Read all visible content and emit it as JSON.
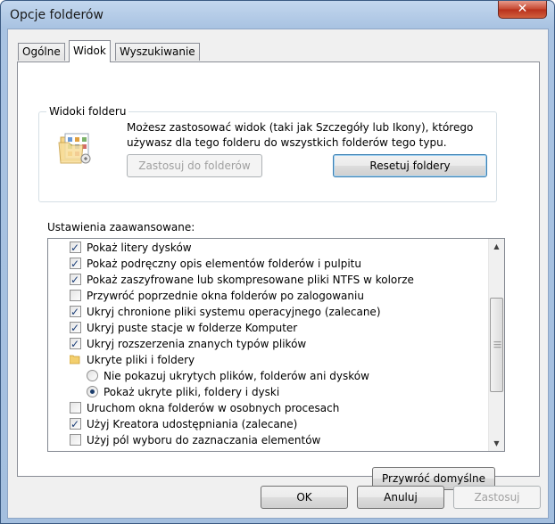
{
  "window": {
    "title": "Opcje folderów",
    "close_glyph": "✕"
  },
  "tabs": [
    {
      "label": "Ogólne",
      "active": false
    },
    {
      "label": "Widok",
      "active": true
    },
    {
      "label": "Wyszukiwanie",
      "active": false
    }
  ],
  "folder_views": {
    "group_label": "Widoki folderu",
    "description": "Możesz zastosować widok (taki jak Szczegóły lub Ikony), którego używasz dla tego folderu do wszystkich folderów tego typu.",
    "apply_button": "Zastosuj do folderów",
    "reset_button": "Resetuj foldery"
  },
  "advanced": {
    "label": "Ustawienia zaawansowane:",
    "items": [
      {
        "type": "checkbox",
        "checked": true,
        "indent": 0,
        "label": "Pokaż litery dysków"
      },
      {
        "type": "checkbox",
        "checked": true,
        "indent": 0,
        "label": "Pokaż podręczny opis elementów folderów i pulpitu"
      },
      {
        "type": "checkbox",
        "checked": true,
        "indent": 0,
        "label": "Pokaż zaszyfrowane lub skompresowane pliki NTFS w kolorze"
      },
      {
        "type": "checkbox",
        "checked": false,
        "indent": 0,
        "label": "Przywróć poprzednie okna folderów po zalogowaniu"
      },
      {
        "type": "checkbox",
        "checked": true,
        "indent": 0,
        "label": "Ukryj chronione pliki systemu operacyjnego (zalecane)"
      },
      {
        "type": "checkbox",
        "checked": true,
        "indent": 0,
        "label": "Ukryj puste stacje w folderze Komputer"
      },
      {
        "type": "checkbox",
        "checked": true,
        "indent": 0,
        "label": "Ukryj rozszerzenia znanych typów plików"
      },
      {
        "type": "folder",
        "checked": false,
        "indent": 0,
        "label": "Ukryte pliki i foldery"
      },
      {
        "type": "radio",
        "checked": false,
        "indent": 1,
        "label": "Nie pokazuj ukrytych plików, folderów ani dysków"
      },
      {
        "type": "radio",
        "checked": true,
        "indent": 1,
        "label": "Pokaż ukryte pliki, foldery i dyski"
      },
      {
        "type": "checkbox",
        "checked": false,
        "indent": 0,
        "label": "Uruchom okna folderów w osobnych procesach"
      },
      {
        "type": "checkbox",
        "checked": true,
        "indent": 0,
        "label": "Użyj Kreatora udostępniania (zalecane)"
      },
      {
        "type": "checkbox",
        "checked": false,
        "indent": 0,
        "label": "Użyj pól wyboru do zaznaczania elementów"
      }
    ]
  },
  "restore_defaults_button": "Przywróć domyślne",
  "footer": {
    "ok": "OK",
    "cancel": "Anuluj",
    "apply": "Zastosuj"
  }
}
